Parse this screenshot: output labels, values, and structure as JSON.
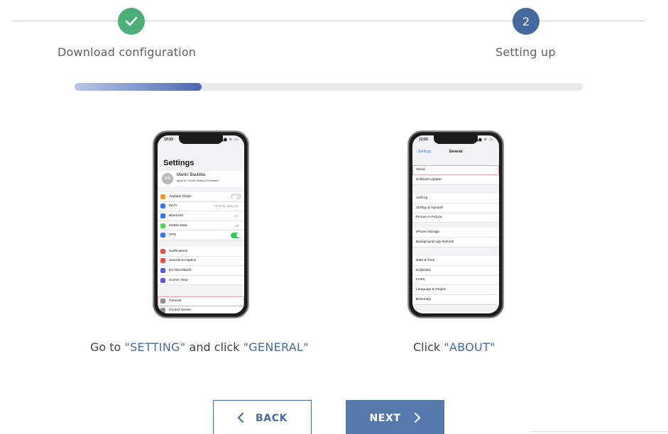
{
  "steps": [
    {
      "number": "",
      "icon": "check-icon",
      "label": "Download configuration",
      "state": "done",
      "color": "#4caf77"
    },
    {
      "number": "2",
      "label": "Setting up",
      "state": "active",
      "color": "#45699e"
    }
  ],
  "progress": {
    "value": 0.25
  },
  "phone1": {
    "status_time": "13:53",
    "status_right": "▂▄▆ ≋ ▭",
    "title": "Settings",
    "profile": {
      "initials": "MB",
      "name": "Martin Bautista",
      "subtitle": "Apple ID, iCloud, Media & Purchases"
    },
    "rows": [
      {
        "label": "Airplane Mode",
        "icon_color": "#f09a37",
        "value": "",
        "toggle": "off"
      },
      {
        "label": "Wi-Fi",
        "icon_color": "#3478f6",
        "value": "TP-Link_1122_5G"
      },
      {
        "label": "Bluetooth",
        "icon_color": "#3478f6",
        "value": "On"
      },
      {
        "label": "Mobile Data",
        "icon_color": "#4cd964",
        "value": "Off"
      },
      {
        "label": "VPN",
        "icon_color": "#3478f6",
        "value": "",
        "toggle": "on"
      },
      {
        "label": "Notifications",
        "icon_color": "#f0504a",
        "value": ""
      },
      {
        "label": "Sounds & Haptics",
        "icon_color": "#f0504a",
        "value": ""
      },
      {
        "label": "Do Not Disturb",
        "icon_color": "#5c5ce0",
        "value": ""
      },
      {
        "label": "Screen Time",
        "icon_color": "#5c5ce0",
        "value": ""
      },
      {
        "label": "General",
        "icon_color": "#8e8e93",
        "value": ""
      },
      {
        "label": "Control Centre",
        "icon_color": "#8e8e93",
        "value": ""
      }
    ]
  },
  "phone2": {
    "status_time": "13:53",
    "status_right": "▂▄▆ ≋ ▭",
    "back_label": "Settings",
    "title": "General",
    "groups": [
      [
        "About",
        "Software Update"
      ],
      [
        "AirDrop",
        "AirPlay & Handoff",
        "Picture in Picture"
      ],
      [
        "iPhone Storage",
        "Background App Refresh"
      ],
      [
        "Date & Time",
        "Keyboard",
        "Fonts",
        "Language & Region",
        "Dictionary"
      ]
    ]
  },
  "captions": {
    "left": {
      "prefix": "Go to ",
      "first": "\"SETTING\"",
      "middle": " and click ",
      "second": "\"GENERAL\""
    },
    "right": {
      "prefix": "Click ",
      "first": "\"ABOUT\""
    }
  },
  "buttons": {
    "back": "BACK",
    "next": "NEXT"
  },
  "colors": {
    "accent": "#45699e",
    "success": "#4caf77",
    "button_fill": "#5578ad"
  }
}
